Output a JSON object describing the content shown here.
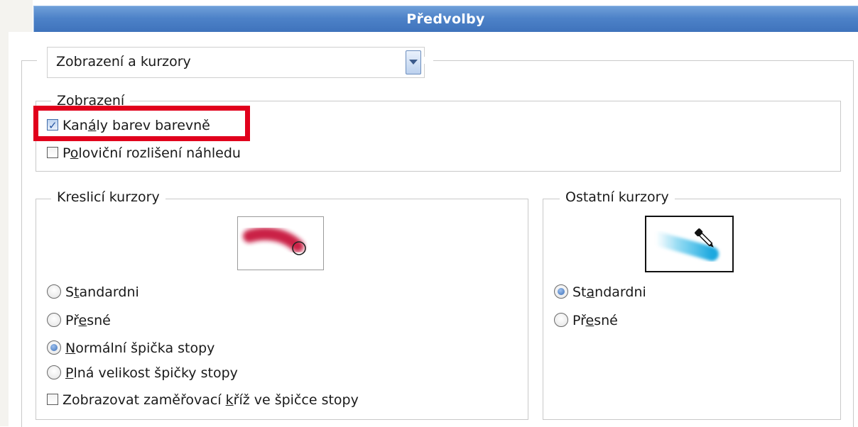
{
  "window": {
    "title": "Předvolby"
  },
  "category_select": {
    "value": "Zobrazení a kurzory"
  },
  "display_group": {
    "legend": "Zobrazení",
    "options": [
      {
        "label_before": "Kan",
        "label_ul": "á",
        "label_after": "ly barev barevně",
        "checked": true
      },
      {
        "label_before": "P",
        "label_ul": "o",
        "label_after": "loviční rozlišení náhledu",
        "checked": false
      }
    ]
  },
  "painting_cursors": {
    "legend": "Kreslicí kurzory",
    "preview_icon": "brush-stroke-preview",
    "options": [
      {
        "label_before": "S",
        "label_ul": "t",
        "label_after": "andardni",
        "type": "radio",
        "checked": false
      },
      {
        "label_before": "Př",
        "label_ul": "e",
        "label_after": "sné",
        "type": "radio",
        "checked": false
      },
      {
        "label_before": "",
        "label_ul": "N",
        "label_after": "ormální špička stopy",
        "type": "radio",
        "checked": true
      },
      {
        "label_before": "",
        "label_ul": "P",
        "label_after": "lná velikost špičky stopy",
        "type": "radio",
        "checked": false
      },
      {
        "label_before": "Zobrazovat zaměřovací ",
        "label_ul": "k",
        "label_after": "říž ve špičce stopy",
        "type": "checkbox",
        "checked": false
      }
    ]
  },
  "other_cursors": {
    "legend": "Ostatní kurzory",
    "preview_icon": "eyedropper-stroke-preview",
    "options": [
      {
        "label_before": "St",
        "label_ul": "a",
        "label_after": "ndardni",
        "type": "radio",
        "checked": true
      },
      {
        "label_before": "Př",
        "label_ul": "e",
        "label_after": "sné",
        "type": "radio",
        "checked": false
      }
    ]
  },
  "colors": {
    "title_bar": "#4d82c8",
    "highlight_box": "#e1001c",
    "brush_stroke": "#c8143c",
    "eyedropper_stroke": "#27b5e6"
  }
}
